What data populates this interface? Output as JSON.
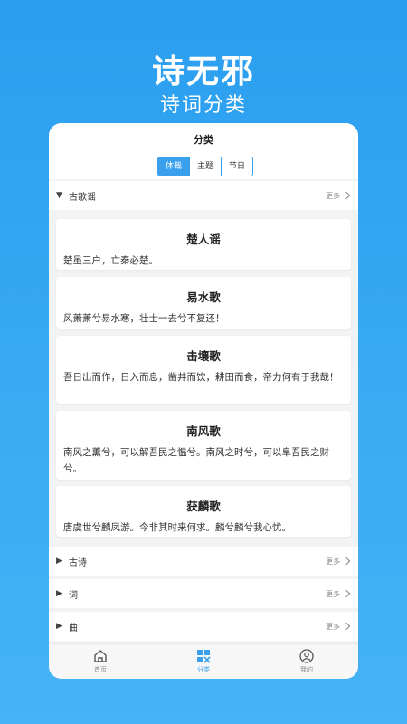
{
  "hero": {
    "title": "诗无邪",
    "subtitle": "诗词分类"
  },
  "page": {
    "title": "分类"
  },
  "segments": [
    {
      "label": "体裁",
      "active": true
    },
    {
      "label": "主题",
      "active": false
    },
    {
      "label": "节日",
      "active": false
    }
  ],
  "categories": [
    {
      "name": "古歌谣",
      "more": "更多",
      "expanded": true
    },
    {
      "name": "古诗",
      "more": "更多",
      "expanded": false
    },
    {
      "name": "词",
      "more": "更多",
      "expanded": false
    },
    {
      "name": "曲",
      "more": "更多",
      "expanded": false
    }
  ],
  "poems": [
    {
      "title": "楚人谣",
      "text": "楚虽三户，亡秦必楚。"
    },
    {
      "title": "易水歌",
      "text": "风萧萧兮易水寒，壮士一去兮不复还！"
    },
    {
      "title": "击壤歌",
      "text": "吾日出而作，日入而息，凿井而饮，耕田而食，帝力何有于我哉！"
    },
    {
      "title": "南风歌",
      "text": "南风之薰兮，可以解吾民之愠兮。南风之时兮，可以阜吾民之财兮。"
    },
    {
      "title": "获麟歌",
      "text": "唐虞世兮麟凤游。今非其时来何求。麟兮麟兮我心忧。"
    }
  ],
  "tabbar": [
    {
      "label": "首页",
      "icon": "home-icon",
      "active": false
    },
    {
      "label": "分类",
      "icon": "category-grid-icon",
      "active": true
    },
    {
      "label": "我的",
      "icon": "profile-icon",
      "active": false
    }
  ],
  "colors": {
    "accent": "#3aa0ee",
    "background_top": "#2b9ef0",
    "background_bottom": "#45b3f5"
  }
}
